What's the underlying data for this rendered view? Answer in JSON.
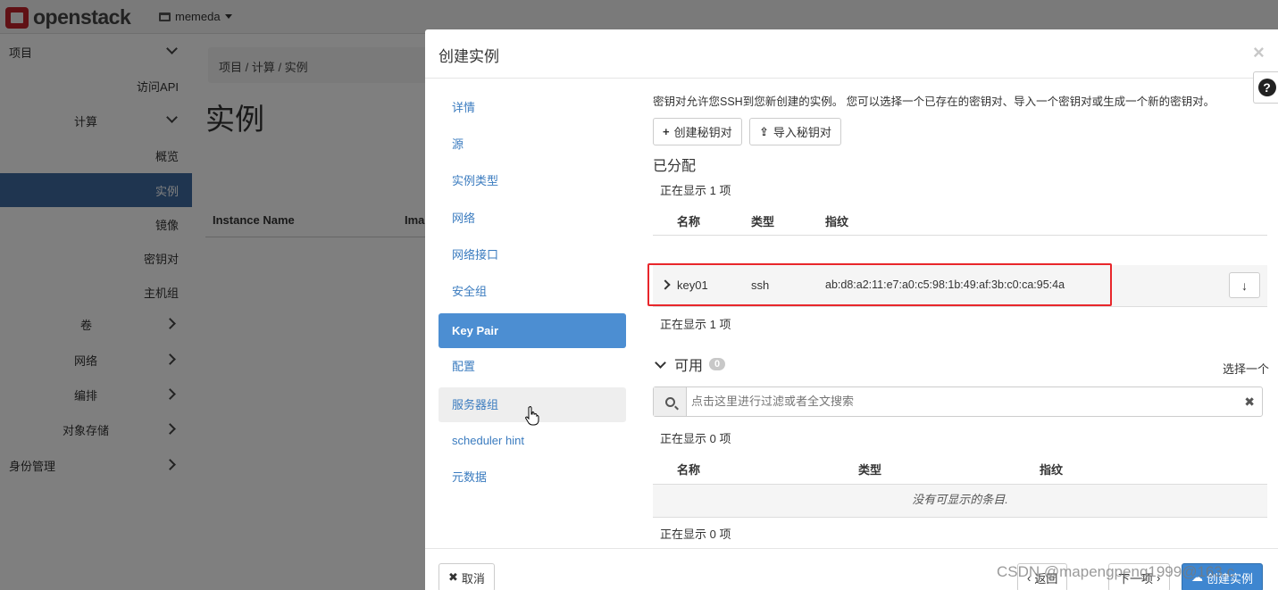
{
  "topbar": {
    "brand": "openstack",
    "project": "memeda"
  },
  "sidebar": {
    "items": [
      {
        "label": "项目",
        "chevron": "down"
      },
      {
        "label": "访问API"
      },
      {
        "label": "计算",
        "chevron": "down"
      },
      {
        "label": "概览"
      },
      {
        "label": "实例",
        "active": true
      },
      {
        "label": "镜像"
      },
      {
        "label": "密钥对"
      },
      {
        "label": "主机组"
      },
      {
        "label": "卷",
        "chevron": "right"
      },
      {
        "label": "网络",
        "chevron": "right"
      },
      {
        "label": "编排",
        "chevron": "right"
      },
      {
        "label": "对象存储",
        "chevron": "right"
      },
      {
        "label": "身份管理",
        "chevron": "right"
      }
    ]
  },
  "page": {
    "breadcrumb": "项目 /  计算 /  实例",
    "title": "实例",
    "columns": [
      "Instance Name",
      "Ima"
    ]
  },
  "modal": {
    "title": "创建实例",
    "close": "×",
    "help": "?",
    "nav": [
      "详情",
      "源",
      "实例类型",
      "网络",
      "网络接口",
      "安全组",
      "Key Pair",
      "配置",
      "服务器组",
      "scheduler hint",
      "元数据"
    ],
    "active_nav": "Key Pair",
    "hover_nav": "服务器组",
    "description": "密钥对允许您SSH到您新创建的实例。 您可以选择一个已存在的密钥对、导入一个密钥对或生成一个新的密钥对。",
    "create_keypair_btn": "创建秘钥对",
    "import_keypair_btn": "导入秘钥对",
    "allocated": {
      "title": "已分配",
      "count_top": "正在显示 1 项",
      "count_bottom": "正在显示 1 项",
      "headers": {
        "name": "名称",
        "type": "类型",
        "fingerprint": "指纹"
      },
      "rows": [
        {
          "name": "key01",
          "type": "ssh",
          "fingerprint": "ab:d8:a2:11:e7:a0:c5:98:1b:49:af:3b:c0:ca:95:4a"
        }
      ]
    },
    "available": {
      "title": "可用",
      "badge": "0",
      "select_one": "选择一个",
      "search_placeholder": "点击这里进行过滤或者全文搜索",
      "count_top": "正在显示 0 项",
      "count_bottom": "正在显示 0 项",
      "headers": {
        "name": "名称",
        "type": "类型",
        "fingerprint": "指纹"
      },
      "empty": "没有可显示的条目."
    },
    "footer": {
      "cancel": "取消",
      "back": "返回",
      "next": "下一项",
      "launch": "创建实例"
    }
  },
  "watermark": "CSDN @mapengpeng1999@163.c",
  "colors": {
    "highlight": "#e8262b",
    "active_nav": "#4c8ed2",
    "sidebar_active": "#3e6aa0",
    "brand_red": "#c0232b"
  }
}
